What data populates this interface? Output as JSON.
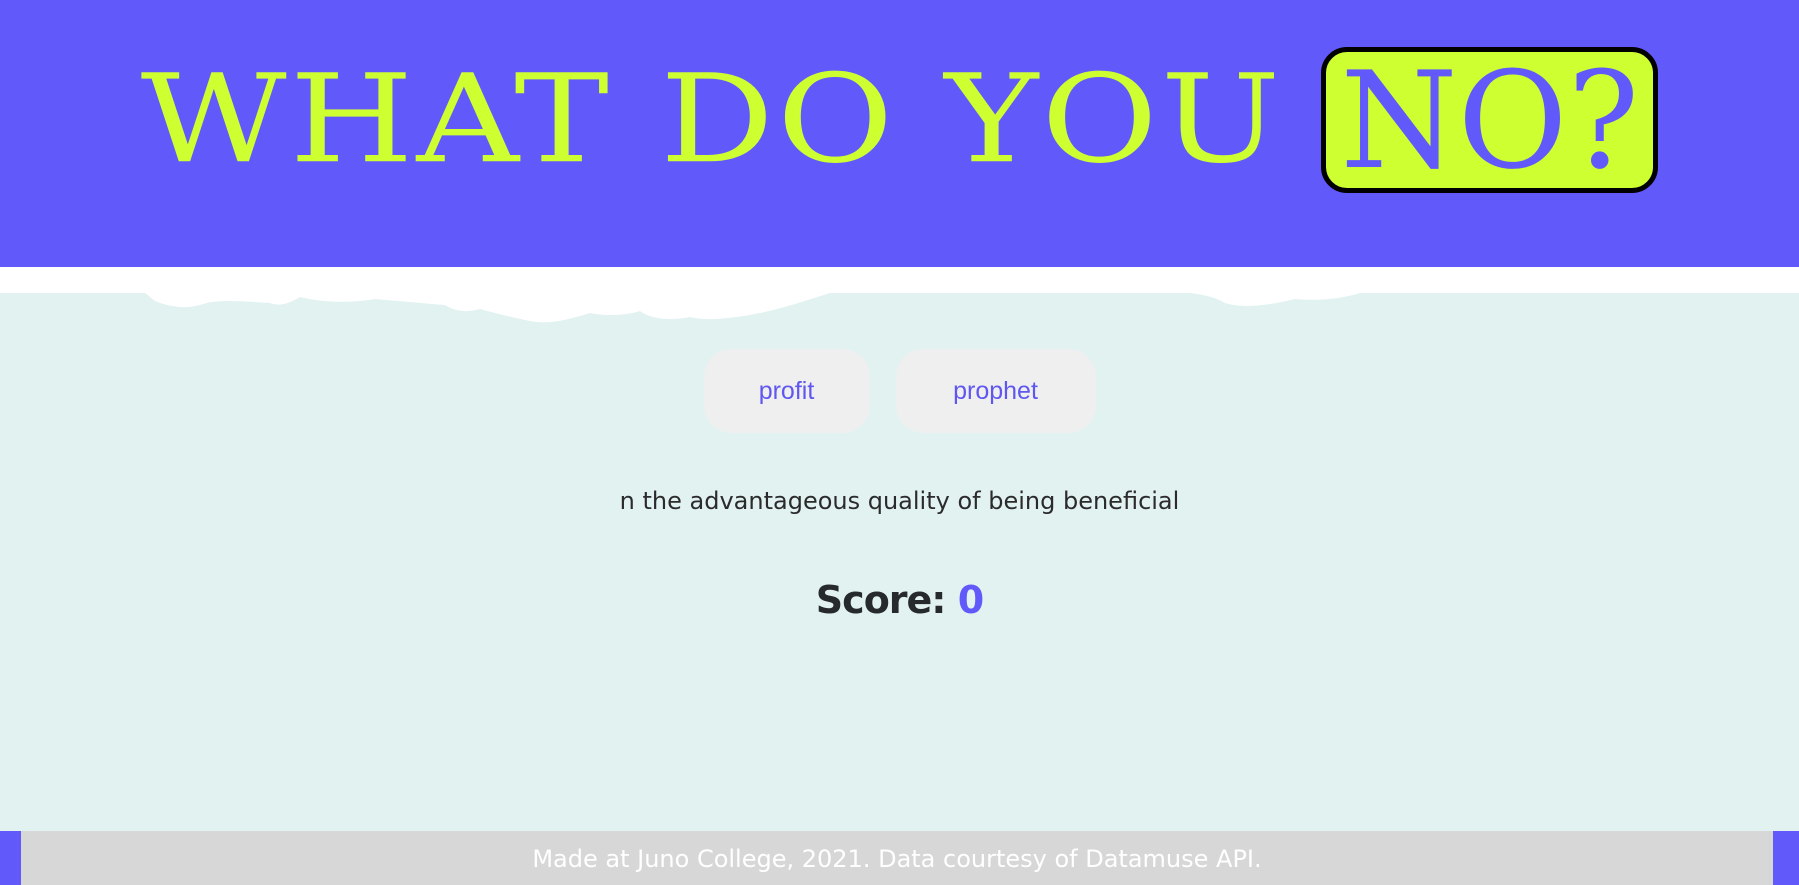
{
  "header": {
    "title_main": "WHAT DO YOU",
    "title_highlight": "NO?"
  },
  "choices": [
    {
      "label": "profit"
    },
    {
      "label": "prophet"
    }
  ],
  "definition": "n the advantageous quality of being beneficial",
  "score": {
    "label": "Score:",
    "value": "0"
  },
  "footer": {
    "text": "Made at Juno College, 2021. Data courtesy of Datamuse API."
  },
  "colors": {
    "header_bg": "#6259fa",
    "title_accent": "#cdff31",
    "page_bg": "#e2f2f1",
    "button_bg": "#efefef",
    "button_text": "#5f57ef",
    "footer_bg": "#d7d7d7"
  }
}
